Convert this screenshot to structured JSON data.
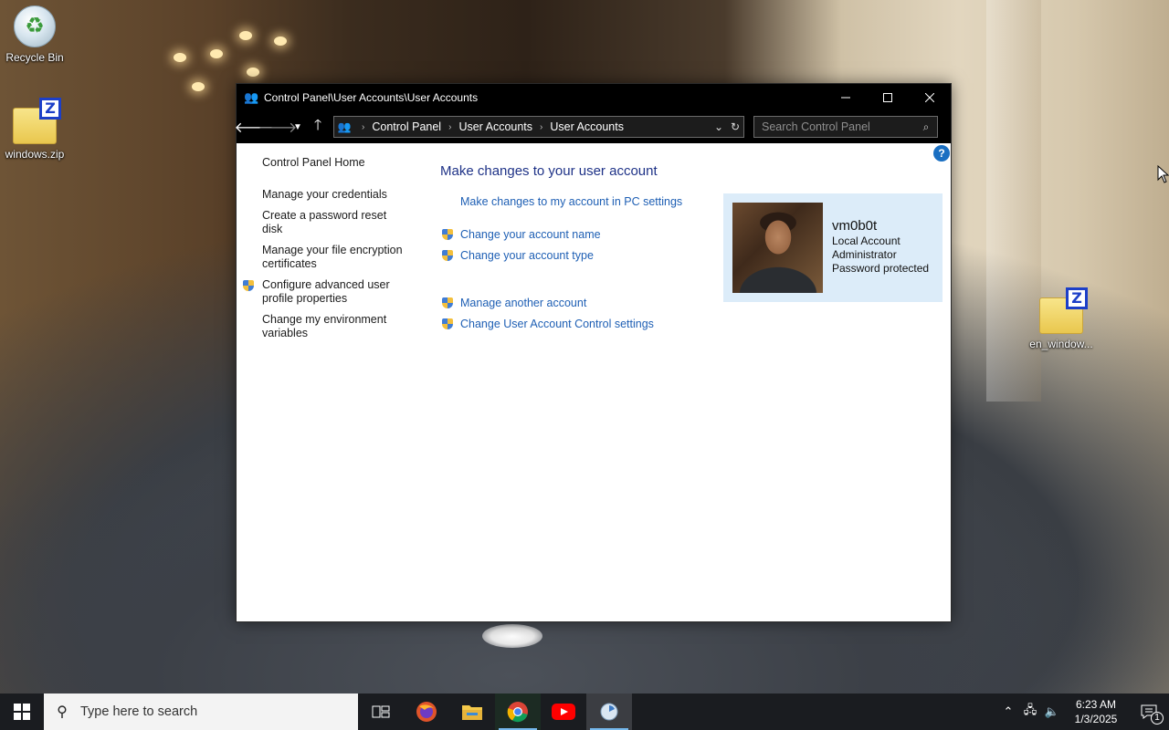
{
  "desktop": {
    "icons": [
      {
        "label": "Recycle Bin",
        "icon": "recycle-bin-icon"
      },
      {
        "label": "windows.zip",
        "icon": "zip-archive-icon"
      },
      {
        "label": "en_window...",
        "icon": "zip-archive-icon"
      }
    ]
  },
  "window": {
    "title": "Control Panel\\User Accounts\\User Accounts",
    "breadcrumb": [
      "Control Panel",
      "User Accounts",
      "User Accounts"
    ],
    "search_placeholder": "Search Control Panel",
    "sidebar": {
      "home": "Control Panel Home",
      "items": [
        {
          "label": "Manage your credentials",
          "shield": false
        },
        {
          "label": "Create a password reset disk",
          "shield": false
        },
        {
          "label": "Manage your file encryption certificates",
          "shield": false
        },
        {
          "label": "Configure advanced user profile properties",
          "shield": true
        },
        {
          "label": "Change my environment variables",
          "shield": false
        }
      ]
    },
    "main": {
      "heading": "Make changes to your user account",
      "pc_settings_link": "Make changes to my account in PC settings",
      "links": [
        "Change your account name",
        "Change your account type",
        "Manage another account",
        "Change User Account Control settings"
      ]
    },
    "account": {
      "name": "vm0b0t",
      "type": "Local Account",
      "role": "Administrator",
      "status": "Password protected"
    },
    "help": "?"
  },
  "taskbar": {
    "search_placeholder": "Type here to search",
    "apps": [
      "task-view-icon",
      "firefox-icon",
      "file-explorer-icon",
      "chrome-icon",
      "youtube-icon",
      "control-panel-icon"
    ],
    "time": "6:23 AM",
    "date": "1/3/2025",
    "notification_count": "1"
  },
  "colors": {
    "link": "#1e5fb4",
    "heading": "#1e3287",
    "account_panel": "#dcecf9",
    "titlebar": "#000000",
    "taskbar": "#1a1c20"
  }
}
